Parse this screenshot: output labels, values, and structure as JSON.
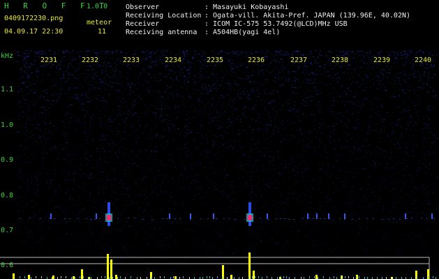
{
  "header": {
    "app_title": "H R O F F T",
    "version": "1.0.0",
    "filename": "0409172230.png",
    "meteor_label": "meteor",
    "meteor_count": "11",
    "datetime": "04.09.17 22:30",
    "info_labels": [
      "Observer",
      "Receiving Location",
      "Receiver",
      "Receiving antenna"
    ],
    "info_values": [
      ": Masayuki Kobayashi",
      ": Ogata-vill. Akita-Pref. JAPAN (139.96E, 40.02N)",
      ": ICOM IC-575 53.7492(@LCD)MHz USB",
      ": A504HB(yagi 4el)"
    ]
  },
  "axis": {
    "y_unit": "kHz",
    "y_ticks": [
      "1.1",
      "1.0",
      "0.9",
      "0.8",
      "0.7",
      "0.6"
    ],
    "time_ticks": [
      "2231",
      "2232",
      "2233",
      "2234",
      "2235",
      "2236",
      "2237",
      "2238",
      "2239",
      "2240"
    ]
  },
  "colors": {
    "background": "#000000",
    "header_text_green": "#3fd23f",
    "header_text_yellow": "#e8e83a",
    "header_text_white": "#f0f0f0",
    "noise_dots": "#1f2aa8",
    "echo_bar": "#ffff00",
    "echo_head": "#ff2a6a"
  }
}
